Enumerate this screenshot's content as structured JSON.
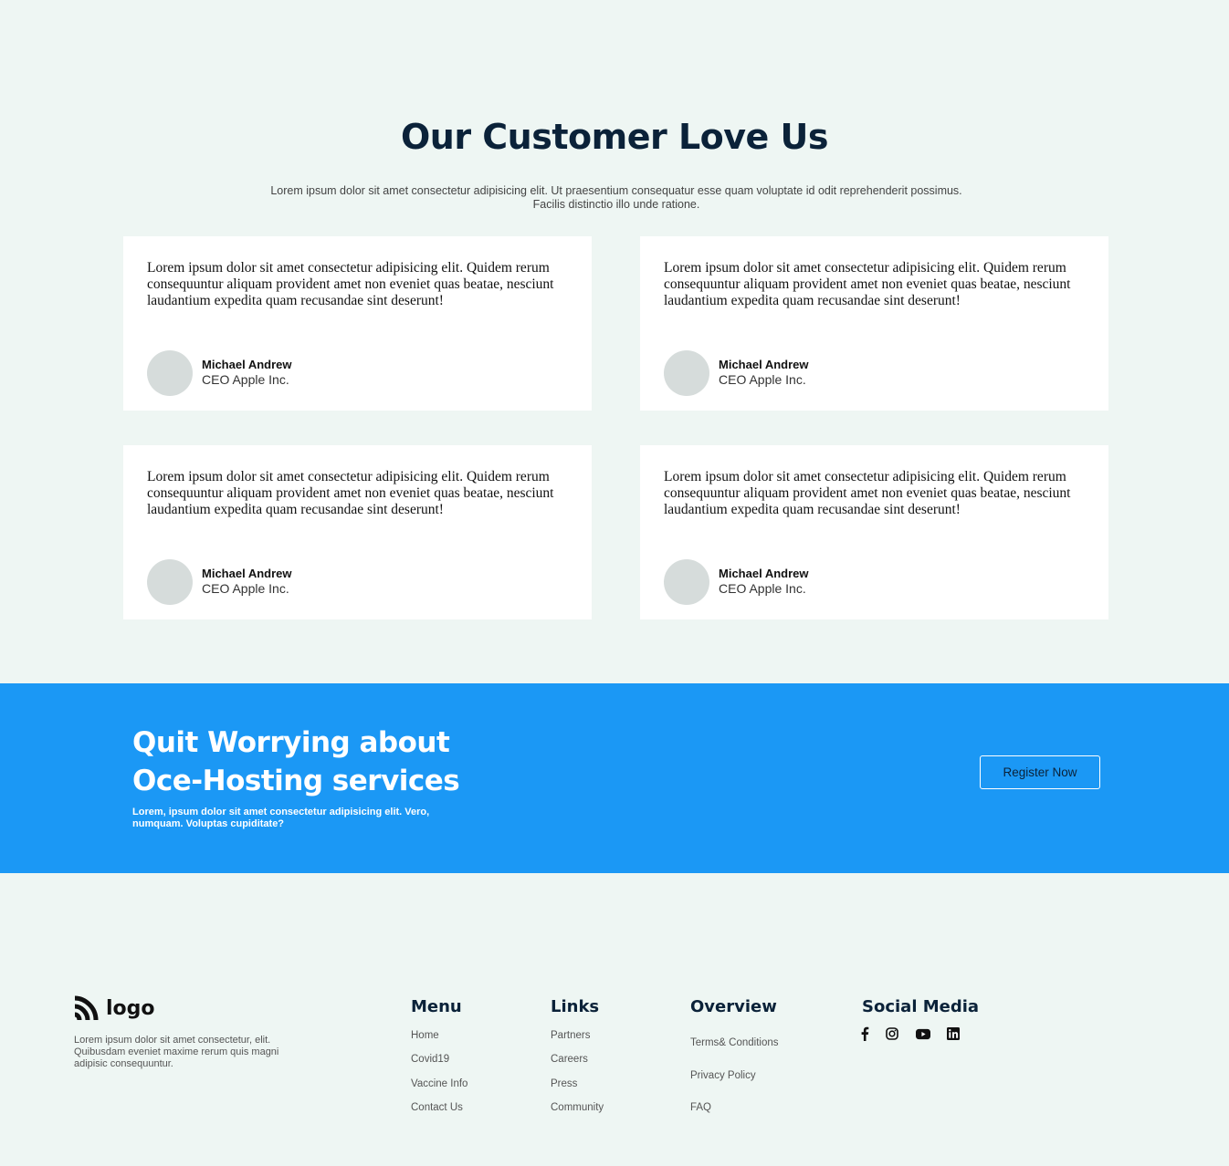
{
  "testimonials": {
    "title": "Our Customer Love Us",
    "subtitle": "Lorem ipsum dolor sit amet consectetur adipisicing elit. Ut praesentium consequatur esse quam voluptate id odit reprehenderit possimus. Facilis distinctio illo unde ratione.",
    "cards": [
      {
        "quote": "Lorem ipsum dolor sit amet consectetur adipisicing elit. Quidem rerum consequuntur aliquam provident amet non eveniet quas beatae, nesciunt laudantium expedita quam recusandae sint deserunt!",
        "name": "Michael Andrew",
        "role": "CEO Apple Inc."
      },
      {
        "quote": "Lorem ipsum dolor sit amet consectetur adipisicing elit. Quidem rerum consequuntur aliquam provident amet non eveniet quas beatae, nesciunt laudantium expedita quam recusandae sint deserunt!",
        "name": "Michael Andrew",
        "role": "CEO Apple Inc."
      },
      {
        "quote": "Lorem ipsum dolor sit amet consectetur adipisicing elit. Quidem rerum consequuntur aliquam provident amet non eveniet quas beatae, nesciunt laudantium expedita quam recusandae sint deserunt!",
        "name": "Michael Andrew",
        "role": "CEO Apple Inc."
      },
      {
        "quote": "Lorem ipsum dolor sit amet consectetur adipisicing elit. Quidem rerum consequuntur aliquam provident amet non eveniet quas beatae, nesciunt laudantium expedita quam recusandae sint deserunt!",
        "name": "Michael Andrew",
        "role": "CEO Apple Inc."
      }
    ]
  },
  "cta": {
    "heading_line1": "Quit Worrying about",
    "heading_line2": "Oce-Hosting services",
    "text": "Lorem, ipsum dolor sit amet consectetur adipisicing elit. Vero, numquam. Voluptas cupiditate?",
    "button_label": "Register Now",
    "background_color": "#1b98f5"
  },
  "footer": {
    "logo_text": "logo",
    "description": "Lorem ipsum dolor sit amet consectetur, elit. Quibusdam eveniet maxime rerum quis magni adipisic consequuntur.",
    "menu": {
      "title": "Menu",
      "items": [
        "Home",
        "Covid19",
        "Vaccine Info",
        "Contact Us"
      ]
    },
    "links": {
      "title": "Links",
      "items": [
        "Partners",
        "Careers",
        "Press",
        "Community"
      ]
    },
    "overview": {
      "title": "Overview",
      "items": [
        "Terms& Conditions",
        "Privacy Policy",
        "FAQ"
      ]
    },
    "social": {
      "title": "Social Media",
      "icons": [
        "facebook-icon",
        "instagram-icon",
        "youtube-icon",
        "linkedin-icon"
      ]
    }
  }
}
